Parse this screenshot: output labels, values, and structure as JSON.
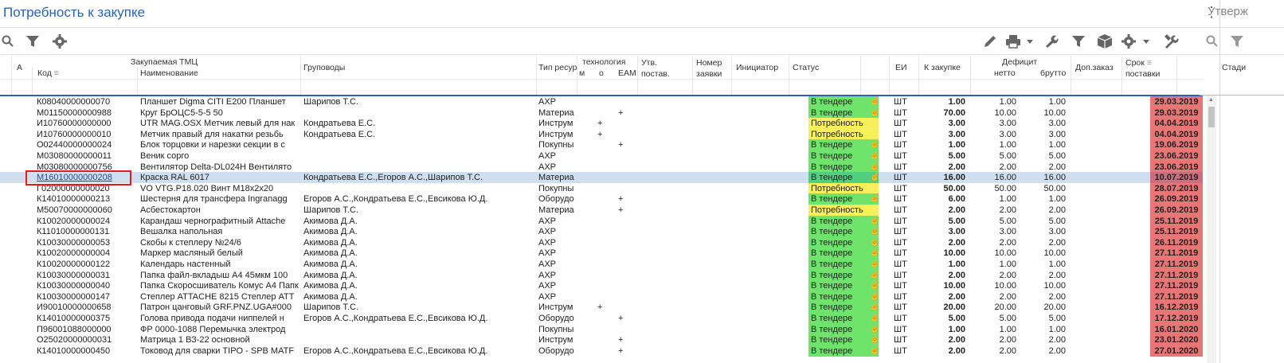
{
  "title": "Потребность к закупке",
  "side_title": "Утверж",
  "side_column": "Стади",
  "toolbar": {
    "left_icons": [
      "search-icon",
      "filter-icon",
      "gear-icon"
    ],
    "right_icons": [
      "pencil-icon",
      "printer-icon",
      "wrench-icon",
      "filter-icon",
      "box-icon",
      "gear-icon",
      "tools-icon"
    ]
  },
  "headers": {
    "a": "A",
    "group_tmc": "Закупаемая ТМЦ",
    "kod": "Код",
    "naim": "Наименование",
    "grup": "Груповоды",
    "tip": "Тип ресур",
    "tech": "технология",
    "tech_m": "м",
    "tech_o": "о",
    "eam": "EAM",
    "utv1": "Утв.",
    "utv2": "постав.",
    "nomer1": "Номер",
    "nomer2": "заявки",
    "init": "Инициатор",
    "status": "Статус",
    "ei": "ЕИ",
    "kzak": "К закупке",
    "def": "Дефицит",
    "netto": "нетто",
    "brutto": "брутто",
    "dop": "Доп.заказ",
    "srok1": "Срок",
    "srok2": "поставки"
  },
  "colors": {
    "accent": "#2a62b8",
    "status_green": "#6fe36c",
    "status_yellow": "#f7f05a",
    "date_red": "#e87676",
    "selected": "#cfdff0"
  },
  "rows": [
    {
      "kod": "К08040000000070",
      "name": "Планшет Digma CITI E200 Планшет",
      "grup": "Шарипов Т.С.",
      "tip": "АХР",
      "m": "",
      "o": "",
      "eam": "",
      "status": "В тендере",
      "st": "g",
      "hand": true,
      "ei": "ШТ",
      "kz": "1.00",
      "netto": "1.00",
      "brutto": "1.00",
      "date": "29.03.2019"
    },
    {
      "kod": "М01150000000988",
      "name": "Круг БрОЦС5-5-5 50",
      "grup": "",
      "tip": "Материа",
      "m": "",
      "o": "",
      "eam": "+",
      "status": "В тендере",
      "st": "g",
      "hand": true,
      "ei": "ШТ",
      "kz": "70.00",
      "netto": "10.00",
      "brutto": "10.00",
      "date": "29.03.2019"
    },
    {
      "kod": "И10760000000000",
      "name": "UTR MAG.OSX Метчик левый для нак",
      "grup": "Кондратьева Е.С.",
      "tip": "Инструм",
      "m": "",
      "o": "+",
      "eam": "",
      "status": "Потребность",
      "st": "y",
      "hand": false,
      "ei": "ШТ",
      "kz": "3.00",
      "netto": "3.00",
      "brutto": "3.00",
      "date": "04.04.2019"
    },
    {
      "kod": "И10760000000010",
      "name": "Метчик правый для накатки резьбь",
      "grup": "Кондратьева Е.С.",
      "tip": "Инструм",
      "m": "",
      "o": "+",
      "eam": "",
      "status": "Потребность",
      "st": "y",
      "hand": false,
      "ei": "ШТ",
      "kz": "3.00",
      "netto": "3.00",
      "brutto": "3.00",
      "date": "04.04.2019"
    },
    {
      "kod": "О02440000000024",
      "name": "Блок торцовки и нарезки секции в с",
      "grup": "",
      "tip": "Покупны",
      "m": "",
      "o": "",
      "eam": "+",
      "status": "В тендере",
      "st": "g",
      "hand": true,
      "ei": "ШТ",
      "kz": "1.00",
      "netto": "1.00",
      "brutto": "1.00",
      "date": "19.06.2019"
    },
    {
      "kod": "М03080000000011",
      "name": "Веник сорго",
      "grup": "",
      "tip": "АХР",
      "m": "",
      "o": "",
      "eam": "",
      "status": "В тендере",
      "st": "g",
      "hand": true,
      "ei": "ШТ",
      "kz": "5.00",
      "netto": "5.00",
      "brutto": "5.00",
      "date": "23.06.2019"
    },
    {
      "kod": "М03080000000756",
      "name": "Вентилятор Delta-DL024H Вентилято",
      "grup": "",
      "tip": "АХР",
      "m": "",
      "o": "",
      "eam": "",
      "status": "В тендере",
      "st": "g",
      "hand": true,
      "ei": "ШТ",
      "kz": "2.00",
      "netto": "2.00",
      "brutto": "2.00",
      "date": "23.06.2019"
    },
    {
      "kod": "М16010000000208",
      "name": " Краска RAL 6017",
      "grup": "Кондратьева Е.С.,Егоров А.С.,Шарипов Т.С.",
      "tip": "Материа",
      "m": "",
      "o": "",
      "eam": "",
      "status": "В тендере",
      "st": "g",
      "hand": true,
      "ei": "ШТ",
      "kz": "16.00",
      "netto": "16.00",
      "brutto": "16.00",
      "date": "10.07.2019",
      "sel": true
    },
    {
      "kod": "Г02000000000020",
      "name": "VO VTG.P18.020 Винт М18х2х20",
      "grup": "",
      "tip": "Покупны",
      "m": "",
      "o": "",
      "eam": "",
      "status": "Потребность",
      "st": "y",
      "hand": false,
      "ei": "ШТ",
      "kz": "50.00",
      "netto": "50.00",
      "brutto": "50.00",
      "date": "28.07.2019"
    },
    {
      "kod": "К14010000000213",
      "name": " Шестерня для трансфера Ingranagg",
      "grup": "Егоров А.С.,Кондратьева Е.С.,Евсикова Ю.Д.",
      "tip": "Оборудо",
      "m": "",
      "o": "",
      "eam": "+",
      "status": "В тендере",
      "st": "g",
      "hand": true,
      "ei": "ШТ",
      "kz": "6.00",
      "netto": "1.00",
      "brutto": "1.00",
      "date": "26.09.2019"
    },
    {
      "kod": "М50070000000060",
      "name": " Асбестокартон",
      "grup": "Шарипов Т.С.",
      "tip": "Материа",
      "m": "",
      "o": "",
      "eam": "+",
      "status": "Потребность",
      "st": "y",
      "hand": false,
      "ei": "ШТ",
      "kz": "2.00",
      "netto": "2.00",
      "brutto": "2.00",
      "date": "26.09.2019"
    },
    {
      "kod": "К10020000000024",
      "name": "Карандаш чернографитный Attache",
      "grup": "Акимова Д.А.",
      "tip": "АХР",
      "m": "",
      "o": "",
      "eam": "",
      "status": "В тендере",
      "st": "g",
      "hand": true,
      "ei": "ШТ",
      "kz": "5.00",
      "netto": "5.00",
      "brutto": "5.00",
      "date": "25.11.2019"
    },
    {
      "kod": "К11010000000131",
      "name": " Вешалка напольная",
      "grup": "Акимова Д.А.",
      "tip": "АХР",
      "m": "",
      "o": "",
      "eam": "",
      "status": "В тендере",
      "st": "g",
      "hand": true,
      "ei": "ШТ",
      "kz": "3.00",
      "netto": "3.00",
      "brutto": "3.00",
      "date": "25.11.2019"
    },
    {
      "kod": "К10030000000053",
      "name": "Скобы к степлеру №24/6",
      "grup": "Акимова Д.А.",
      "tip": "АХР",
      "m": "",
      "o": "",
      "eam": "",
      "status": "В тендере",
      "st": "g",
      "hand": true,
      "ei": "ШТ",
      "kz": "2.00",
      "netto": "2.00",
      "brutto": "2.00",
      "date": "26.11.2019"
    },
    {
      "kod": "К10020000000004",
      "name": " Маркер масляный белый",
      "grup": "Акимова Д.А.",
      "tip": "АХР",
      "m": "",
      "o": "",
      "eam": "",
      "status": "В тендере",
      "st": "g",
      "hand": true,
      "ei": "ШТ",
      "kz": "10.00",
      "netto": "10.00",
      "brutto": "10.00",
      "date": "27.11.2019"
    },
    {
      "kod": "К10020000000122",
      "name": "Календарь настенный",
      "grup": "Акимова Д.А.",
      "tip": "АХР",
      "m": "",
      "o": "",
      "eam": "",
      "status": "В тендере",
      "st": "g",
      "hand": true,
      "ei": "ШТ",
      "kz": "1.00",
      "netto": "1.00",
      "brutto": "1.00",
      "date": "27.11.2019"
    },
    {
      "kod": "К10030000000031",
      "name": "Папка файл-вкладыш А4 45мкм 100",
      "grup": "Акимова Д.А.",
      "tip": "АХР",
      "m": "",
      "o": "",
      "eam": "",
      "status": "В тендере",
      "st": "g",
      "hand": true,
      "ei": "ШТ",
      "kz": "2.00",
      "netto": "2.00",
      "brutto": "2.00",
      "date": "27.11.2019"
    },
    {
      "kod": "К10030000000040",
      "name": "Папка Скоросшиватель Комус А4 Папк",
      "grup": "Акимова Д.А.",
      "tip": "АХР",
      "m": "",
      "o": "",
      "eam": "",
      "status": "В тендере",
      "st": "g",
      "hand": true,
      "ei": "ШТ",
      "kz": "10.00",
      "netto": "10.00",
      "brutto": "10.00",
      "date": "27.11.2019"
    },
    {
      "kod": "К10030000000147",
      "name": "Степлер ATTACHE 8215 Степлер АТТ",
      "grup": "Акимова Д.А.",
      "tip": "АХР",
      "m": "",
      "o": "",
      "eam": "",
      "status": "В тендере",
      "st": "g",
      "hand": true,
      "ei": "ШТ",
      "kz": "2.00",
      "netto": "2.00",
      "brutto": "2.00",
      "date": "27.11.2019"
    },
    {
      "kod": "И90010000000658",
      "name": "Патрон цанговый GRF.PNZ.UGA#000",
      "grup": "Шарипов Т.С.",
      "tip": "Инструм",
      "m": "",
      "o": "+",
      "eam": "",
      "status": "В тендере",
      "st": "g",
      "hand": true,
      "ei": "ШТ",
      "kz": "20.00",
      "netto": "20.00",
      "brutto": "20.00",
      "date": "16.12.2019"
    },
    {
      "kod": "К14010000000375",
      "name": "Голова привода подачи ниппелей н",
      "grup": "Егоров А.С.,Кондратьева Е.С.,Евсикова Ю.Д.",
      "tip": "Оборудо",
      "m": "",
      "o": "",
      "eam": "+",
      "status": "В тендере",
      "st": "g",
      "hand": true,
      "ei": "ШТ",
      "kz": "5.00",
      "netto": "5.00",
      "brutto": "5.00",
      "date": "17.12.2019"
    },
    {
      "kod": "П96001088000000",
      "name": "ФР 0000-1088 Перемычка электрод",
      "grup": "",
      "tip": "Покупны",
      "m": "",
      "o": "",
      "eam": "",
      "status": "В тендере",
      "st": "g",
      "hand": true,
      "ei": "ШТ",
      "kz": "1.00",
      "netto": "1.00",
      "brutto": "1.00",
      "date": "16.01.2020"
    },
    {
      "kod": "О25020000000031",
      "name": "Матрица 1 ВЗ-22 основной",
      "grup": "",
      "tip": "Инструм",
      "m": "",
      "o": "",
      "eam": "+",
      "status": "В тендере",
      "st": "g",
      "hand": true,
      "ei": "ШТ",
      "kz": "2.00",
      "netto": "2.00",
      "brutto": "2.00",
      "date": "23.01.2020"
    },
    {
      "kod": "К14010000000450",
      "name": "Токовод для сварки TIPO - SPB MATF",
      "grup": "Егоров А.С.,Кондратьева Е.С.,Евсикова Ю.Д.",
      "tip": "Оборудо",
      "m": "",
      "o": "",
      "eam": "+",
      "status": "В тендере",
      "st": "g",
      "hand": true,
      "ei": "ШТ",
      "kz": "2.00",
      "netto": "2.00",
      "brutto": "2.00",
      "date": "27.01.2020"
    }
  ]
}
